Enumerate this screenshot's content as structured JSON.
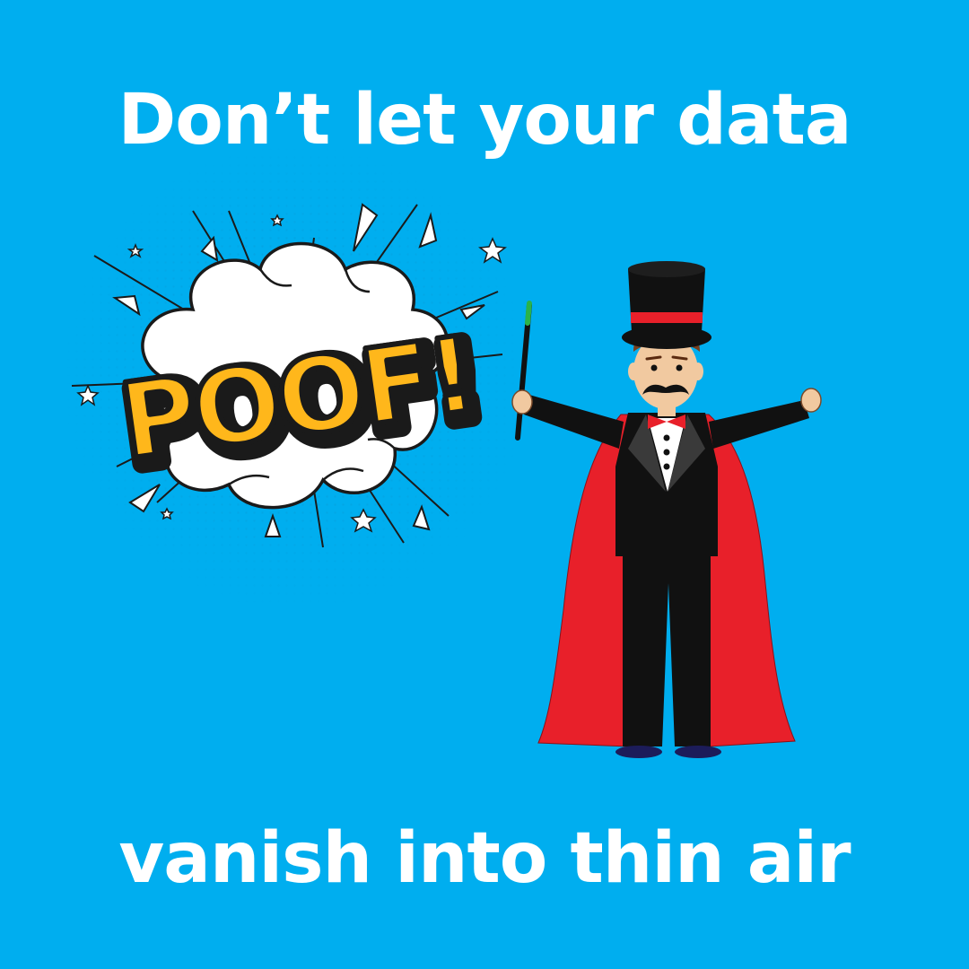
{
  "headline": {
    "top": "Don’t let your data",
    "bottom": "vanish into thin air"
  },
  "poof": {
    "text": "POOF!"
  },
  "colors": {
    "background": "#00AEEF",
    "text": "#FFFFFF",
    "poof_fill": "#FFB71B",
    "cape": "#E8202A",
    "suit": "#111111"
  }
}
